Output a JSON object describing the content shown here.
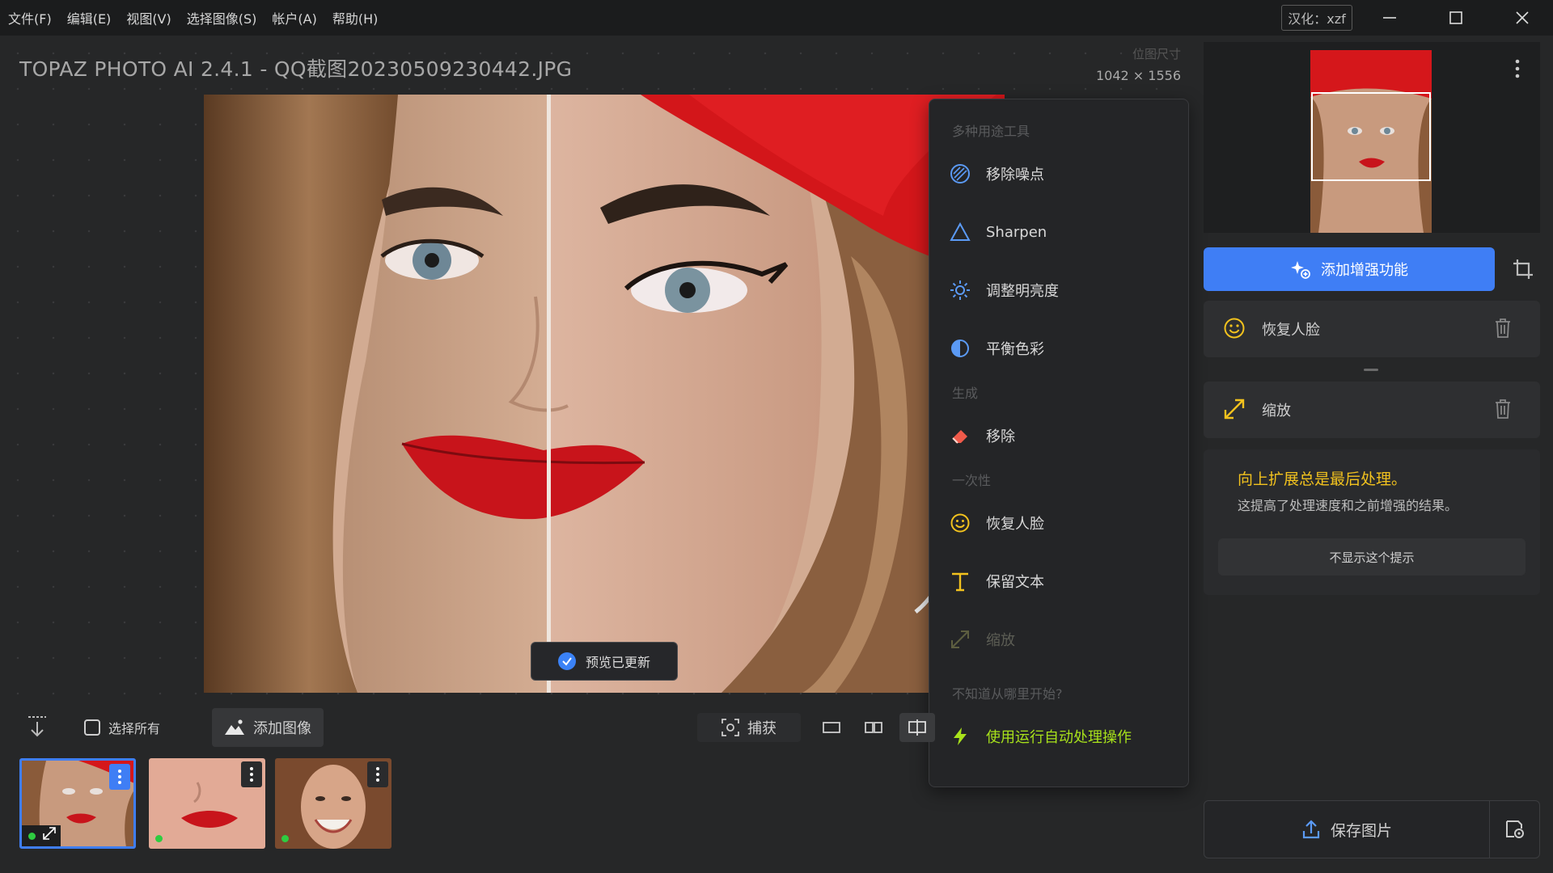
{
  "menu": [
    "文件(F)",
    "编辑(E)",
    "视图(V)",
    "选择图像(S)",
    "帐户(A)",
    "帮助(H)"
  ],
  "locale_badge": "汉化：xzf",
  "document": {
    "title": "TOPAZ PHOTO AI 2.4.1 - QQ截图20230509230442.JPG",
    "size_label": "位图尺寸",
    "size_value": "1042 × 1556"
  },
  "toast": "预览已更新",
  "dropdown": {
    "section_multi": "多种用途工具",
    "denoise": "移除噪点",
    "sharpen": "Sharpen",
    "brightness": "调整明亮度",
    "color": "平衡色彩",
    "section_generate": "生成",
    "remove": "移除",
    "section_once": "一次性",
    "face": "恢复人脸",
    "text": "保留文本",
    "upscale": "缩放",
    "section_help": "不知道从哪里开始?",
    "autopilot": "使用运行自动处理操作"
  },
  "panel": {
    "add_enhancement": "添加增强功能",
    "cards": [
      "恢复人脸",
      "缩放"
    ],
    "tip_title": "向上扩展总是最后处理。",
    "tip_body": "这提高了处理速度和之前增强的结果。",
    "tip_dismiss": "不显示这个提示",
    "save": "保存图片"
  },
  "bottom": {
    "select_all": "选择所有",
    "add_image": "添加图像",
    "capture": "捕获"
  },
  "colors": {
    "accent": "#3f7ef5",
    "tip_title": "#f2c21e",
    "autopilot": "#a8e21b",
    "icon_yellow": "#f2c21e"
  }
}
